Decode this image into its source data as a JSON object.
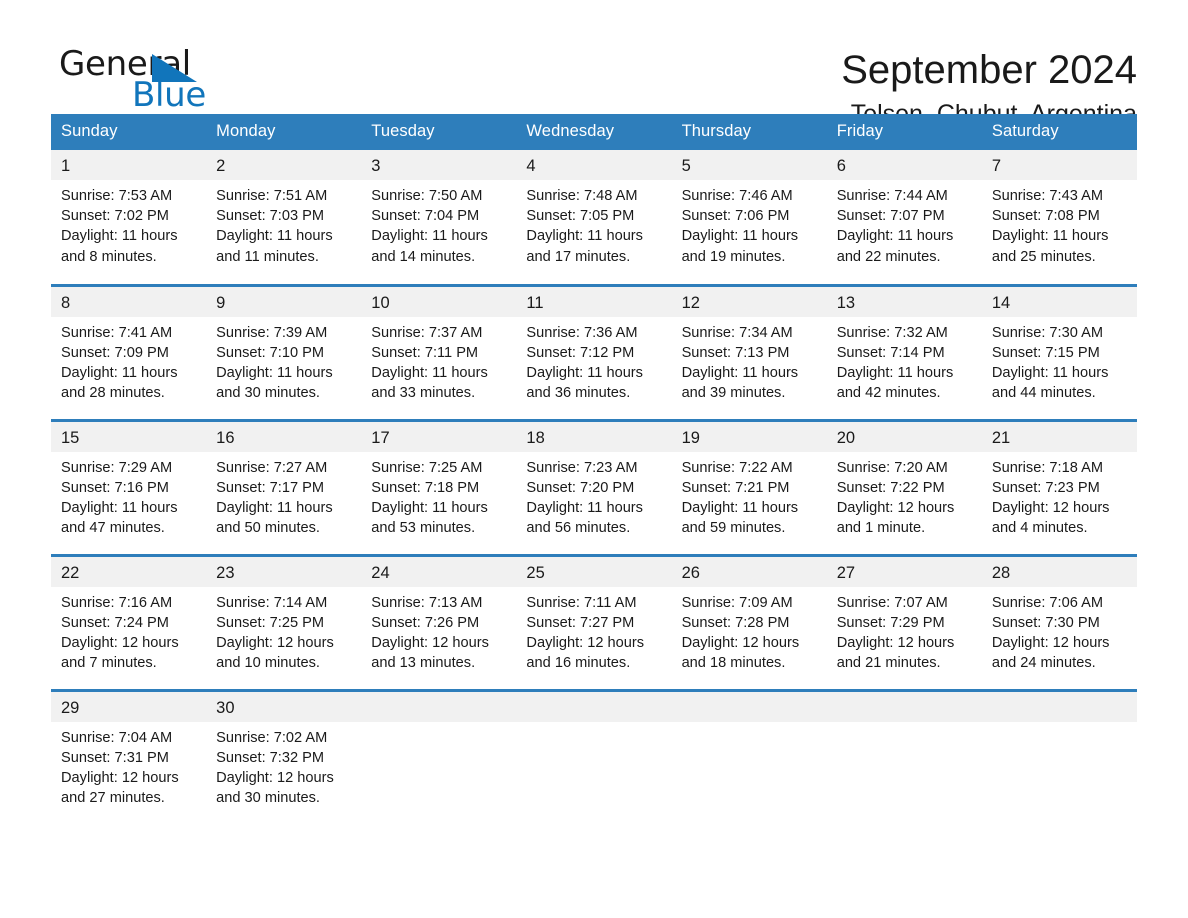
{
  "logo": {
    "word_one": "General",
    "word_two": "Blue",
    "triangle_color": "#1175bb",
    "icon": "general-blue-logo"
  },
  "header": {
    "month_title": "September 2024",
    "location": "Telsen, Chubut, Argentina"
  },
  "theme": {
    "header_blue": "#2e7ebb",
    "row_divider_blue": "#2e7ebb",
    "date_band_gray": "#f1f1f1",
    "text_color": "#1a1a1a"
  },
  "calendar": {
    "weekday_headers": [
      "Sunday",
      "Monday",
      "Tuesday",
      "Wednesday",
      "Thursday",
      "Friday",
      "Saturday"
    ],
    "weeks": [
      [
        {
          "day": "1",
          "sunrise": "Sunrise: 7:53 AM",
          "sunset": "Sunset: 7:02 PM",
          "daylight": "Daylight: 11 hours and 8 minutes."
        },
        {
          "day": "2",
          "sunrise": "Sunrise: 7:51 AM",
          "sunset": "Sunset: 7:03 PM",
          "daylight": "Daylight: 11 hours and 11 minutes."
        },
        {
          "day": "3",
          "sunrise": "Sunrise: 7:50 AM",
          "sunset": "Sunset: 7:04 PM",
          "daylight": "Daylight: 11 hours and 14 minutes."
        },
        {
          "day": "4",
          "sunrise": "Sunrise: 7:48 AM",
          "sunset": "Sunset: 7:05 PM",
          "daylight": "Daylight: 11 hours and 17 minutes."
        },
        {
          "day": "5",
          "sunrise": "Sunrise: 7:46 AM",
          "sunset": "Sunset: 7:06 PM",
          "daylight": "Daylight: 11 hours and 19 minutes."
        },
        {
          "day": "6",
          "sunrise": "Sunrise: 7:44 AM",
          "sunset": "Sunset: 7:07 PM",
          "daylight": "Daylight: 11 hours and 22 minutes."
        },
        {
          "day": "7",
          "sunrise": "Sunrise: 7:43 AM",
          "sunset": "Sunset: 7:08 PM",
          "daylight": "Daylight: 11 hours and 25 minutes."
        }
      ],
      [
        {
          "day": "8",
          "sunrise": "Sunrise: 7:41 AM",
          "sunset": "Sunset: 7:09 PM",
          "daylight": "Daylight: 11 hours and 28 minutes."
        },
        {
          "day": "9",
          "sunrise": "Sunrise: 7:39 AM",
          "sunset": "Sunset: 7:10 PM",
          "daylight": "Daylight: 11 hours and 30 minutes."
        },
        {
          "day": "10",
          "sunrise": "Sunrise: 7:37 AM",
          "sunset": "Sunset: 7:11 PM",
          "daylight": "Daylight: 11 hours and 33 minutes."
        },
        {
          "day": "11",
          "sunrise": "Sunrise: 7:36 AM",
          "sunset": "Sunset: 7:12 PM",
          "daylight": "Daylight: 11 hours and 36 minutes."
        },
        {
          "day": "12",
          "sunrise": "Sunrise: 7:34 AM",
          "sunset": "Sunset: 7:13 PM",
          "daylight": "Daylight: 11 hours and 39 minutes."
        },
        {
          "day": "13",
          "sunrise": "Sunrise: 7:32 AM",
          "sunset": "Sunset: 7:14 PM",
          "daylight": "Daylight: 11 hours and 42 minutes."
        },
        {
          "day": "14",
          "sunrise": "Sunrise: 7:30 AM",
          "sunset": "Sunset: 7:15 PM",
          "daylight": "Daylight: 11 hours and 44 minutes."
        }
      ],
      [
        {
          "day": "15",
          "sunrise": "Sunrise: 7:29 AM",
          "sunset": "Sunset: 7:16 PM",
          "daylight": "Daylight: 11 hours and 47 minutes."
        },
        {
          "day": "16",
          "sunrise": "Sunrise: 7:27 AM",
          "sunset": "Sunset: 7:17 PM",
          "daylight": "Daylight: 11 hours and 50 minutes."
        },
        {
          "day": "17",
          "sunrise": "Sunrise: 7:25 AM",
          "sunset": "Sunset: 7:18 PM",
          "daylight": "Daylight: 11 hours and 53 minutes."
        },
        {
          "day": "18",
          "sunrise": "Sunrise: 7:23 AM",
          "sunset": "Sunset: 7:20 PM",
          "daylight": "Daylight: 11 hours and 56 minutes."
        },
        {
          "day": "19",
          "sunrise": "Sunrise: 7:22 AM",
          "sunset": "Sunset: 7:21 PM",
          "daylight": "Daylight: 11 hours and 59 minutes."
        },
        {
          "day": "20",
          "sunrise": "Sunrise: 7:20 AM",
          "sunset": "Sunset: 7:22 PM",
          "daylight": "Daylight: 12 hours and 1 minute."
        },
        {
          "day": "21",
          "sunrise": "Sunrise: 7:18 AM",
          "sunset": "Sunset: 7:23 PM",
          "daylight": "Daylight: 12 hours and 4 minutes."
        }
      ],
      [
        {
          "day": "22",
          "sunrise": "Sunrise: 7:16 AM",
          "sunset": "Sunset: 7:24 PM",
          "daylight": "Daylight: 12 hours and 7 minutes."
        },
        {
          "day": "23",
          "sunrise": "Sunrise: 7:14 AM",
          "sunset": "Sunset: 7:25 PM",
          "daylight": "Daylight: 12 hours and 10 minutes."
        },
        {
          "day": "24",
          "sunrise": "Sunrise: 7:13 AM",
          "sunset": "Sunset: 7:26 PM",
          "daylight": "Daylight: 12 hours and 13 minutes."
        },
        {
          "day": "25",
          "sunrise": "Sunrise: 7:11 AM",
          "sunset": "Sunset: 7:27 PM",
          "daylight": "Daylight: 12 hours and 16 minutes."
        },
        {
          "day": "26",
          "sunrise": "Sunrise: 7:09 AM",
          "sunset": "Sunset: 7:28 PM",
          "daylight": "Daylight: 12 hours and 18 minutes."
        },
        {
          "day": "27",
          "sunrise": "Sunrise: 7:07 AM",
          "sunset": "Sunset: 7:29 PM",
          "daylight": "Daylight: 12 hours and 21 minutes."
        },
        {
          "day": "28",
          "sunrise": "Sunrise: 7:06 AM",
          "sunset": "Sunset: 7:30 PM",
          "daylight": "Daylight: 12 hours and 24 minutes."
        }
      ],
      [
        {
          "day": "29",
          "sunrise": "Sunrise: 7:04 AM",
          "sunset": "Sunset: 7:31 PM",
          "daylight": "Daylight: 12 hours and 27 minutes."
        },
        {
          "day": "30",
          "sunrise": "Sunrise: 7:02 AM",
          "sunset": "Sunset: 7:32 PM",
          "daylight": "Daylight: 12 hours and 30 minutes."
        },
        {
          "day": "",
          "sunrise": "",
          "sunset": "",
          "daylight": ""
        },
        {
          "day": "",
          "sunrise": "",
          "sunset": "",
          "daylight": ""
        },
        {
          "day": "",
          "sunrise": "",
          "sunset": "",
          "daylight": ""
        },
        {
          "day": "",
          "sunrise": "",
          "sunset": "",
          "daylight": ""
        },
        {
          "day": "",
          "sunrise": "",
          "sunset": "",
          "daylight": ""
        }
      ]
    ]
  }
}
